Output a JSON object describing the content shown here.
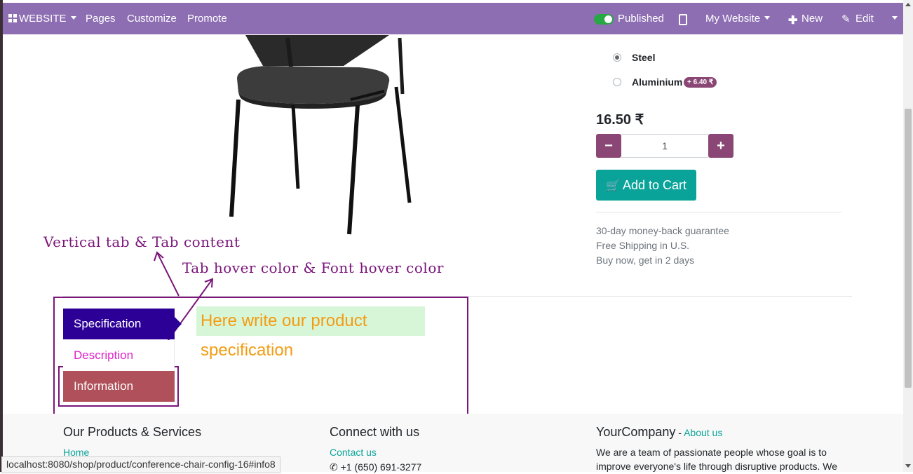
{
  "topbar": {
    "brand": "WEBSITE",
    "menu": [
      "Pages",
      "Customize",
      "Promote"
    ],
    "published": "Published",
    "website_select": "My Website",
    "new_label": "New",
    "edit_label": "Edit"
  },
  "product": {
    "attribute_options": [
      {
        "label": "Steel",
        "checked": true
      },
      {
        "label": "Aluminium",
        "extra": "+ 6.40 ₹",
        "checked": false
      }
    ],
    "price": "16.50 ₹",
    "quantity": "1",
    "qty_minus": "−",
    "qty_plus": "+",
    "add_to_cart": "Add to Cart",
    "guarantees": [
      "30-day money-back guarantee",
      "Free Shipping in U.S.",
      "Buy now, get in 2 days"
    ]
  },
  "annotations": {
    "vertical_tab": "Vertical tab & Tab content",
    "hover_color": "Tab hover color & Font hover color"
  },
  "tabs": {
    "items": [
      "Specification",
      "Description",
      "Information"
    ],
    "active_content": "Here write our product specification"
  },
  "footer": {
    "col1_title": "Our Products & Services",
    "col1_link": "Home",
    "col2_title": "Connect with us",
    "col2_link": "Contact us",
    "col2_phone": "+1 (650) 691-3277",
    "col3_title": "YourCompany",
    "col3_sep": " - ",
    "col3_link": "About us",
    "col3_text": "We are a team of passionate people whose goal is to improve everyone's life through disruptive products. We"
  },
  "status_url": "localhost:8080/shop/product/conference-chair-config-16#info8",
  "colors": {
    "navbar": "#8d6eb3",
    "primary": "#8a4674",
    "cart": "#0aa399",
    "annotation": "#7a157a",
    "tab_active": "#2c0097",
    "tab_hover": "#b0505a",
    "tab_font_hover": "#e023c9",
    "content_text": "#f39c12",
    "content_bg": "#d7f5d7"
  }
}
